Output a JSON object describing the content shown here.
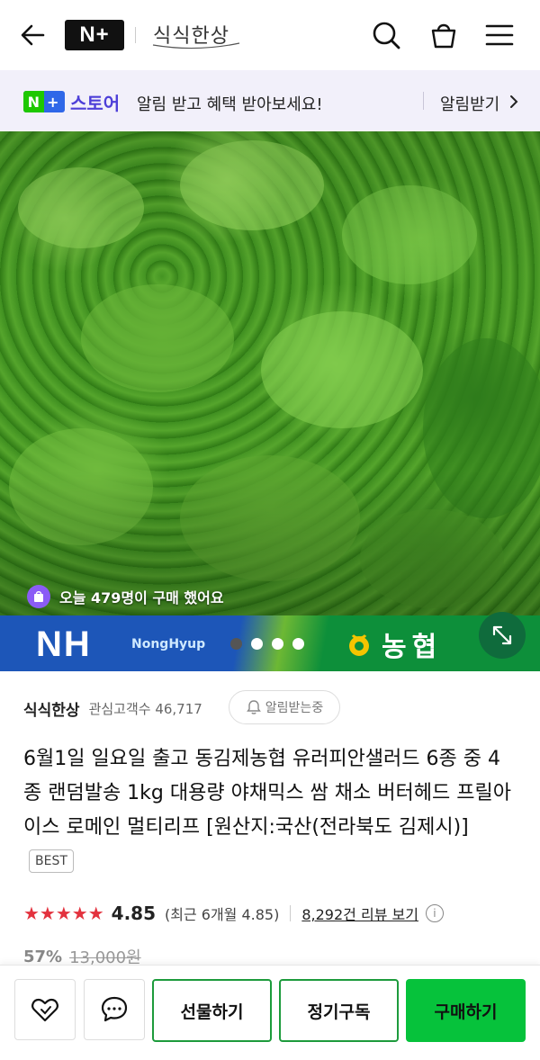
{
  "header": {
    "badge_label": "N+",
    "store_name": "식식한상",
    "icons": [
      "back-arrow-icon",
      "search-icon",
      "shopping-bag-icon",
      "hamburger-menu-icon"
    ]
  },
  "promo": {
    "logo_badge": "N+",
    "logo_label": "스토어",
    "message": "알림 받고 혜택 받아보세요!",
    "cta": "알림받기"
  },
  "hero": {
    "buyers_text": "오늘 479명이 구매 했어요"
  },
  "banner": {
    "brand_en": "NH",
    "brand_sub": "NongHyup",
    "brand_kr": "농협",
    "carousel_active_index": 0,
    "carousel_count": 4
  },
  "seller": {
    "name": "식식한상",
    "fans": "관심고객수 46,717",
    "alarm_label": "알림받는중"
  },
  "product": {
    "title": "6월1일 일요일 출고 동김제농협 유러피안샐러드 6종 중 4종 랜덤발송 1kg 대용량 야채믹스 쌈 채소 버터헤드 프릴아이스 로메인 멀티리프 [원산지:국산(전라북도 김제시)]",
    "best_badge": "BEST",
    "stars": "★★★★★",
    "rating": "4.85",
    "recent_rating": "(최근 6개월 4.85)",
    "reviews_link": "8,292건 리뷰 보기",
    "discount": "57%",
    "original_price": "13,000원"
  },
  "actions": {
    "gift": "선물하기",
    "subscribe": "정기구독",
    "buy": "구매하기"
  },
  "colors": {
    "buy_green": "#06c23b",
    "outline_green": "#1d9b3c",
    "star_red": "#e3323e",
    "store_purple": "#4d3fd8"
  }
}
